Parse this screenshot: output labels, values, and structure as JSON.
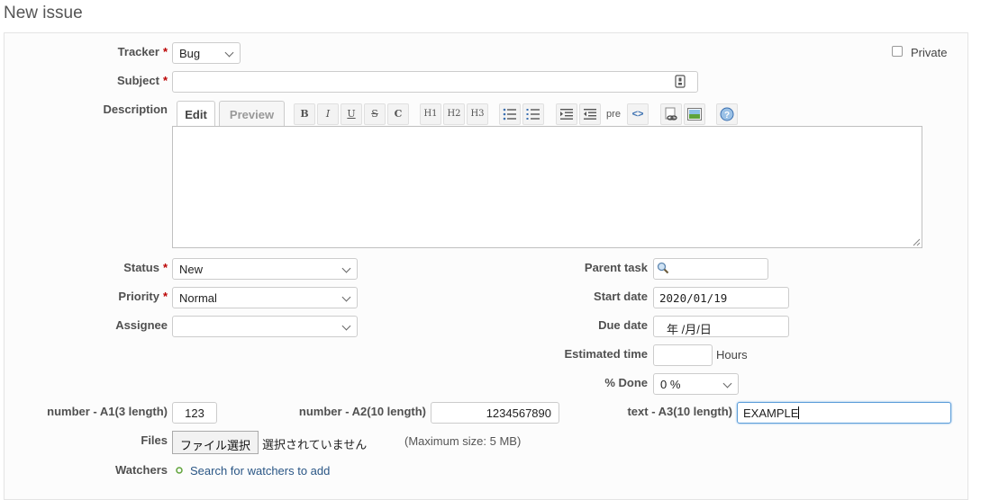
{
  "page": {
    "title": "New issue"
  },
  "fields": {
    "tracker": {
      "label": "Tracker",
      "value": "Bug"
    },
    "private": {
      "label": "Private",
      "checked": false
    },
    "subject": {
      "label": "Subject",
      "value": ""
    },
    "description": {
      "label": "Description",
      "value": ""
    },
    "status": {
      "label": "Status",
      "value": "New"
    },
    "priority": {
      "label": "Priority",
      "value": "Normal"
    },
    "assignee": {
      "label": "Assignee",
      "value": ""
    },
    "parent_task": {
      "label": "Parent task",
      "value": ""
    },
    "start_date": {
      "label": "Start date",
      "value": "2020/01/19"
    },
    "due_date": {
      "label": "Due date",
      "value": "年 /月/日"
    },
    "estimated_time": {
      "label": "Estimated time",
      "value": "",
      "unit": "Hours"
    },
    "done": {
      "label": "% Done",
      "value": "0 %"
    },
    "number_a1": {
      "label": "number - A1(3 length)",
      "value": "123"
    },
    "number_a2": {
      "label": "number - A2(10 length)",
      "value": "1234567890"
    },
    "text_a3": {
      "label": "text - A3(10 length)",
      "value": "EXAMPLE"
    },
    "files": {
      "label": "Files",
      "button": "ファイル選択",
      "status": "選択されていません",
      "max_size": "(Maximum size: 5 MB)"
    },
    "watchers": {
      "label": "Watchers",
      "link": "Search for watchers to add"
    }
  },
  "required_marker": "*",
  "editor": {
    "tabs": {
      "edit": "Edit",
      "preview": "Preview"
    },
    "toolbar": {
      "bold": "B",
      "italic": "I",
      "underline": "U",
      "strike": "S",
      "code": "C",
      "h1": "H1",
      "h2": "H2",
      "h3": "H3",
      "pre": "pre",
      "inline_code": "<>"
    },
    "icons": [
      "bold-icon",
      "italic-icon",
      "underline-icon",
      "strikethrough-icon",
      "code-icon",
      "heading1-icon",
      "heading2-icon",
      "heading3-icon",
      "bullet-list-icon",
      "numbered-list-icon",
      "indent-icon",
      "outdent-icon",
      "pre-icon",
      "inline-code-icon",
      "link-icon",
      "image-icon",
      "help-icon"
    ]
  },
  "colors": {
    "required": "#bb0000",
    "link": "#2a5685",
    "focus": "#5b9dd9",
    "accent_green": "#5fa33a"
  }
}
